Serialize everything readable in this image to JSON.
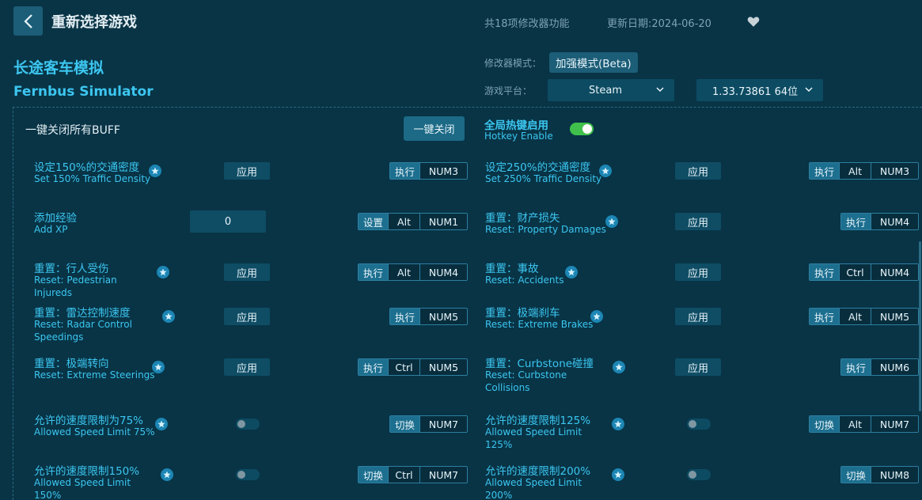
{
  "header": {
    "back_label": "返回",
    "title": "重新选择游戏",
    "feature_count": "共18项修改器功能",
    "update_date": "更新日期:2024-06-20"
  },
  "game": {
    "name_cn": "长途客车模拟",
    "name_en": "Fernbus Simulator"
  },
  "meta": {
    "mode_label": "修改器模式：",
    "mode_value": "加强模式(Beta)",
    "platform_label": "游戏平台：",
    "platform_value": "Steam",
    "version_value": "1.33.73861 64位"
  },
  "global": {
    "buff_label": "一键关闭所有BUFF",
    "close_all_label": "一键关闭",
    "hotkey_title": "全局热键启用",
    "hotkey_subtitle": "Hotkey Enable",
    "hotkey_enabled": true
  },
  "features": [
    {
      "cn": "设定150%的交通密度",
      "en": "Set 150% Traffic Density",
      "control": "应用",
      "action": "执行",
      "keys": [
        "NUM3"
      ]
    },
    {
      "cn": "设定250%的交通密度",
      "en": "Set 250% Traffic Density",
      "control": "应用",
      "action": "执行",
      "keys": [
        "Alt",
        "NUM3"
      ]
    },
    {
      "cn": "添加经验",
      "en": "Add XP",
      "input_value": "0",
      "action": "设置",
      "keys": [
        "Alt",
        "NUM1"
      ]
    },
    {
      "cn": "重置：财产损失",
      "en": "Reset: Property Damages",
      "control": "应用",
      "action": "执行",
      "keys": [
        "NUM4"
      ]
    },
    {
      "cn": "重置：行人受伤",
      "en": "Reset: Pedestrian Injureds",
      "control": "应用",
      "action": "执行",
      "keys": [
        "Alt",
        "NUM4"
      ]
    },
    {
      "cn": "重置：事故",
      "en": "Reset: Accidents",
      "control": "应用",
      "action": "执行",
      "keys": [
        "Ctrl",
        "NUM4"
      ]
    },
    {
      "cn": "重置：雷达控制速度",
      "en": "Reset: Radar Control Speedings",
      "control": "应用",
      "action": "执行",
      "keys": [
        "NUM5"
      ]
    },
    {
      "cn": "重置：极端刹车",
      "en": "Reset: Extreme Brakes",
      "control": "应用",
      "action": "执行",
      "keys": [
        "Alt",
        "NUM5"
      ]
    },
    {
      "cn": "重置：极端转向",
      "en": "Reset: Extreme Steerings",
      "control": "应用",
      "action": "执行",
      "keys": [
        "Ctrl",
        "NUM5"
      ]
    },
    {
      "cn": "重置：Curbstone碰撞",
      "en": "Reset: Curbstone Collisions",
      "control": "应用",
      "action": "执行",
      "keys": [
        "NUM6"
      ]
    },
    {
      "cn": "允许的速度限制为75%",
      "en": "Allowed Speed Limit 75%",
      "toggle": false,
      "action": "切换",
      "keys": [
        "NUM7"
      ]
    },
    {
      "cn": "允许的速度限制125%",
      "en": "Allowed Speed Limit 125%",
      "toggle": false,
      "action": "切换",
      "keys": [
        "Alt",
        "NUM7"
      ]
    },
    {
      "cn": "允许的速度限制150%",
      "en": "Allowed Speed Limit 150%",
      "toggle": false,
      "action": "切换",
      "keys": [
        "Ctrl",
        "NUM7"
      ]
    },
    {
      "cn": "允许的速度限制200%",
      "en": "Allowed Speed Limit 200%",
      "toggle": false,
      "action": "切换",
      "keys": [
        "NUM8"
      ]
    }
  ]
}
